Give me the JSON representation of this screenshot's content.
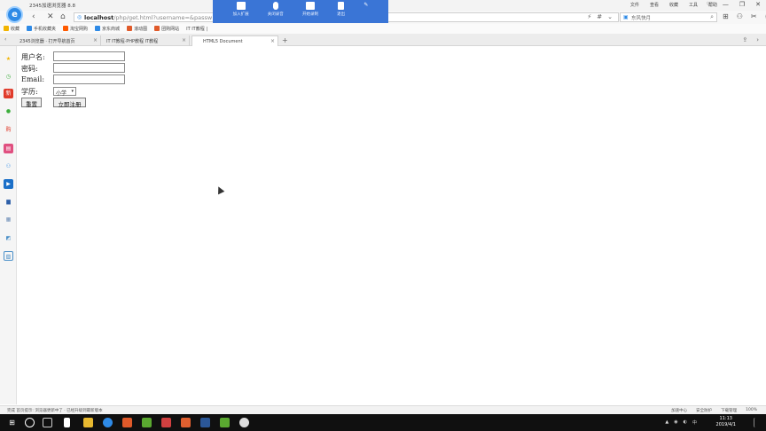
{
  "window": {
    "app_title": "2345加速浏览器 8.8",
    "title_menu": [
      "文件",
      "查看",
      "收藏",
      "工具",
      "帮助"
    ],
    "controls": [
      "♡",
      "—",
      "❐",
      "✕"
    ]
  },
  "address_bar": {
    "url_host": "localhost",
    "url_rest": "/php/get.html?username=&passw",
    "search_placeholder": "东风快月",
    "tools": [
      "⚡",
      "#",
      "⌄"
    ]
  },
  "recorder": {
    "items": [
      "加入扩展",
      "关闭录音",
      "开始录制",
      "退出"
    ]
  },
  "bookmarks": [
    {
      "label": "收藏",
      "color": "#f2b400"
    },
    {
      "label": "手机收藏夹",
      "color": "#2e8ae6"
    },
    {
      "label": "淘宝网购",
      "color": "#ff5a00"
    },
    {
      "label": "京东商城",
      "color": "#2e8ae6"
    },
    {
      "label": "滚动图",
      "color": "#e05a2a"
    },
    {
      "label": "团购网站",
      "color": "#e05a2a"
    },
    {
      "label": "IT IT教程 |",
      "color": "#888888"
    }
  ],
  "tabs": [
    {
      "label": "2345浏览器 · 打开导航首页"
    },
    {
      "label": "IT IT教程·PHP教程 IT教程"
    },
    {
      "label": "HTML5 Document"
    }
  ],
  "form": {
    "username_label": "用户名:",
    "password_label": "密码:",
    "email_label": "Email:",
    "education_label": "学历:",
    "education_selected": "小学",
    "reset_label": "重置",
    "submit_label": "立即注册"
  },
  "status": {
    "left": "完成  首页提示: 浏览器更新中了 · 已经升级到最新版本",
    "right": [
      "加速中心",
      "安全防护",
      "下载管理",
      "100%"
    ]
  },
  "taskbar": {
    "time": "11:13",
    "date": "2019/4/1"
  }
}
